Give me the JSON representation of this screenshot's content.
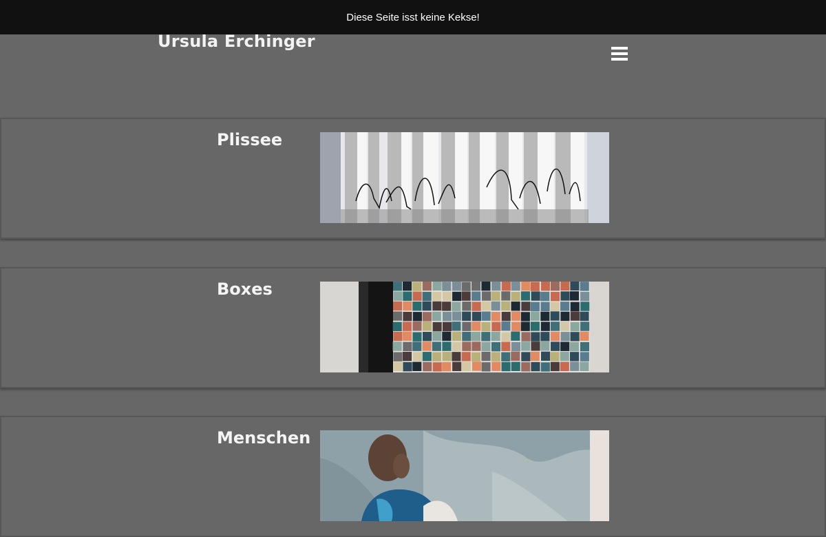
{
  "cookie_notice": "Diese Seite isst keine Kekse!",
  "site": {
    "title": "Ursula Erchinger",
    "menu_icon": "hamburger-menu-icon"
  },
  "galleries": [
    {
      "title": "Plissee"
    },
    {
      "title": "Boxes"
    },
    {
      "title": "Menschen"
    }
  ],
  "colors": {
    "background": "#676767",
    "cookie_bar": "#111111",
    "text": "#f4f4f4"
  }
}
